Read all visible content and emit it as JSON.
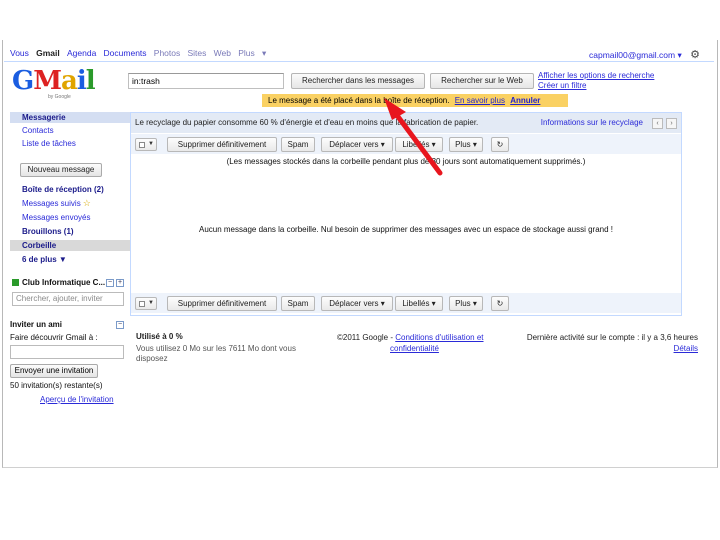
{
  "topnav": {
    "items": [
      "Vous",
      "Gmail",
      "Agenda",
      "Documents",
      "Photos",
      "Sites",
      "Web",
      "Plus",
      "▾"
    ],
    "account": "capmail00@gmail.com ▾",
    "gear": "⚙"
  },
  "logo": {
    "g": "G",
    "m": "M",
    "a": "a",
    "i": "i",
    "l": "l",
    "sub": "by Google"
  },
  "search": {
    "value": "in:trash",
    "mail_button": "Rechercher dans les messages",
    "web_button": "Rechercher sur le Web",
    "link_options": "Afficher les options de recherche",
    "link_filter": "Créer un filtre"
  },
  "notice": {
    "text": "Le message a été placé dans la boîte de réception.",
    "learn_more": "En savoir plus",
    "undo": "Annuler"
  },
  "sidebar": {
    "items": [
      {
        "label": "Messagerie"
      },
      {
        "label": "Contacts"
      },
      {
        "label": "Liste de tâches"
      }
    ],
    "compose": "Nouveau message",
    "folders": [
      {
        "label": "Boîte de réception (2)"
      },
      {
        "label": "Messages suivis"
      },
      {
        "label": "Messages envoyés"
      },
      {
        "label": "Brouillons (1)"
      },
      {
        "label": "Corbeille"
      },
      {
        "label": "6 de plus ▼"
      }
    ],
    "chat_title": "Club Informatique C...",
    "chat_search": "Chercher, ajouter, inviter",
    "invite_title": "Inviter un ami",
    "invite_text": "Faire découvrir Gmail à :",
    "invite_button": "Envoyer une invitation",
    "invite_remaining": "50 invitation(s) restante(s)",
    "invite_preview": "Aperçu de l'invitation"
  },
  "main": {
    "info_text": "Le recyclage du papier consomme 60 % d'énergie et d'eau en moins que la fabrication de papier.",
    "info_link": "Informations sur le recyclage",
    "toolbar": {
      "delete": "Supprimer définitivement",
      "spam": "Spam",
      "move": "Déplacer vers ▾",
      "labels": "Libellés ▾",
      "more": "Plus ▾",
      "refresh": "↻"
    },
    "trash_note": "(Les messages stockés dans la corbeille pendant plus de 30 jours sont automatiquement supprimés.)",
    "empty_msg": "Aucun message dans la corbeille. Nul besoin de supprimer des messages avec un espace de stockage aussi grand !"
  },
  "footer": {
    "usage": "Utilisé à 0 %",
    "usage_detail1": "Vous utilisez 0 Mo sur les 7611 Mo dont vous",
    "usage_detail2": "disposez",
    "copyright": "©2011 Google -",
    "terms": "Conditions d'utilisation et",
    "privacy": "confidentialité",
    "activity": "Dernière activité sur le compte : il y a 3,6 heures",
    "details": "Détails"
  },
  "colors": {
    "accent": "#2a2ad8",
    "notice_bg": "#fad163",
    "arrow": "#e8161e"
  }
}
